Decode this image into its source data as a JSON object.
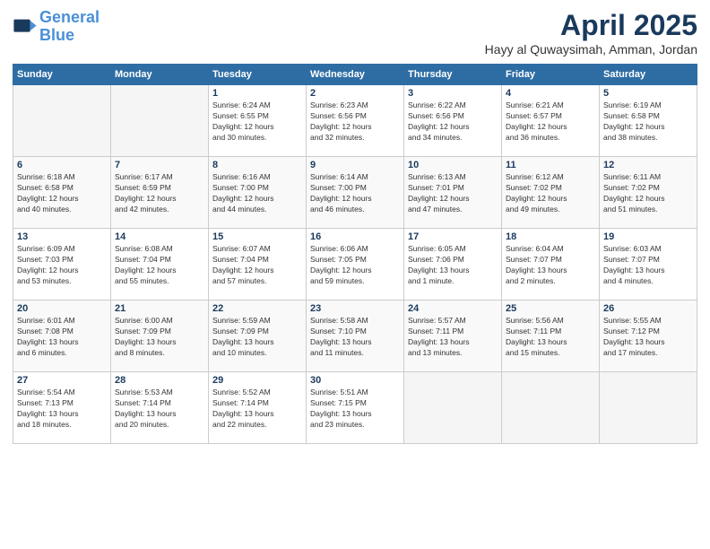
{
  "logo": {
    "line1": "General",
    "line2": "Blue"
  },
  "title": "April 2025",
  "subtitle": "Hayy al Quwaysimah, Amman, Jordan",
  "weekdays": [
    "Sunday",
    "Monday",
    "Tuesday",
    "Wednesday",
    "Thursday",
    "Friday",
    "Saturday"
  ],
  "weeks": [
    [
      {
        "day": "",
        "info": ""
      },
      {
        "day": "",
        "info": ""
      },
      {
        "day": "1",
        "info": "Sunrise: 6:24 AM\nSunset: 6:55 PM\nDaylight: 12 hours\nand 30 minutes."
      },
      {
        "day": "2",
        "info": "Sunrise: 6:23 AM\nSunset: 6:56 PM\nDaylight: 12 hours\nand 32 minutes."
      },
      {
        "day": "3",
        "info": "Sunrise: 6:22 AM\nSunset: 6:56 PM\nDaylight: 12 hours\nand 34 minutes."
      },
      {
        "day": "4",
        "info": "Sunrise: 6:21 AM\nSunset: 6:57 PM\nDaylight: 12 hours\nand 36 minutes."
      },
      {
        "day": "5",
        "info": "Sunrise: 6:19 AM\nSunset: 6:58 PM\nDaylight: 12 hours\nand 38 minutes."
      }
    ],
    [
      {
        "day": "6",
        "info": "Sunrise: 6:18 AM\nSunset: 6:58 PM\nDaylight: 12 hours\nand 40 minutes."
      },
      {
        "day": "7",
        "info": "Sunrise: 6:17 AM\nSunset: 6:59 PM\nDaylight: 12 hours\nand 42 minutes."
      },
      {
        "day": "8",
        "info": "Sunrise: 6:16 AM\nSunset: 7:00 PM\nDaylight: 12 hours\nand 44 minutes."
      },
      {
        "day": "9",
        "info": "Sunrise: 6:14 AM\nSunset: 7:00 PM\nDaylight: 12 hours\nand 46 minutes."
      },
      {
        "day": "10",
        "info": "Sunrise: 6:13 AM\nSunset: 7:01 PM\nDaylight: 12 hours\nand 47 minutes."
      },
      {
        "day": "11",
        "info": "Sunrise: 6:12 AM\nSunset: 7:02 PM\nDaylight: 12 hours\nand 49 minutes."
      },
      {
        "day": "12",
        "info": "Sunrise: 6:11 AM\nSunset: 7:02 PM\nDaylight: 12 hours\nand 51 minutes."
      }
    ],
    [
      {
        "day": "13",
        "info": "Sunrise: 6:09 AM\nSunset: 7:03 PM\nDaylight: 12 hours\nand 53 minutes."
      },
      {
        "day": "14",
        "info": "Sunrise: 6:08 AM\nSunset: 7:04 PM\nDaylight: 12 hours\nand 55 minutes."
      },
      {
        "day": "15",
        "info": "Sunrise: 6:07 AM\nSunset: 7:04 PM\nDaylight: 12 hours\nand 57 minutes."
      },
      {
        "day": "16",
        "info": "Sunrise: 6:06 AM\nSunset: 7:05 PM\nDaylight: 12 hours\nand 59 minutes."
      },
      {
        "day": "17",
        "info": "Sunrise: 6:05 AM\nSunset: 7:06 PM\nDaylight: 13 hours\nand 1 minute."
      },
      {
        "day": "18",
        "info": "Sunrise: 6:04 AM\nSunset: 7:07 PM\nDaylight: 13 hours\nand 2 minutes."
      },
      {
        "day": "19",
        "info": "Sunrise: 6:03 AM\nSunset: 7:07 PM\nDaylight: 13 hours\nand 4 minutes."
      }
    ],
    [
      {
        "day": "20",
        "info": "Sunrise: 6:01 AM\nSunset: 7:08 PM\nDaylight: 13 hours\nand 6 minutes."
      },
      {
        "day": "21",
        "info": "Sunrise: 6:00 AM\nSunset: 7:09 PM\nDaylight: 13 hours\nand 8 minutes."
      },
      {
        "day": "22",
        "info": "Sunrise: 5:59 AM\nSunset: 7:09 PM\nDaylight: 13 hours\nand 10 minutes."
      },
      {
        "day": "23",
        "info": "Sunrise: 5:58 AM\nSunset: 7:10 PM\nDaylight: 13 hours\nand 11 minutes."
      },
      {
        "day": "24",
        "info": "Sunrise: 5:57 AM\nSunset: 7:11 PM\nDaylight: 13 hours\nand 13 minutes."
      },
      {
        "day": "25",
        "info": "Sunrise: 5:56 AM\nSunset: 7:11 PM\nDaylight: 13 hours\nand 15 minutes."
      },
      {
        "day": "26",
        "info": "Sunrise: 5:55 AM\nSunset: 7:12 PM\nDaylight: 13 hours\nand 17 minutes."
      }
    ],
    [
      {
        "day": "27",
        "info": "Sunrise: 5:54 AM\nSunset: 7:13 PM\nDaylight: 13 hours\nand 18 minutes."
      },
      {
        "day": "28",
        "info": "Sunrise: 5:53 AM\nSunset: 7:14 PM\nDaylight: 13 hours\nand 20 minutes."
      },
      {
        "day": "29",
        "info": "Sunrise: 5:52 AM\nSunset: 7:14 PM\nDaylight: 13 hours\nand 22 minutes."
      },
      {
        "day": "30",
        "info": "Sunrise: 5:51 AM\nSunset: 7:15 PM\nDaylight: 13 hours\nand 23 minutes."
      },
      {
        "day": "",
        "info": ""
      },
      {
        "day": "",
        "info": ""
      },
      {
        "day": "",
        "info": ""
      }
    ]
  ]
}
